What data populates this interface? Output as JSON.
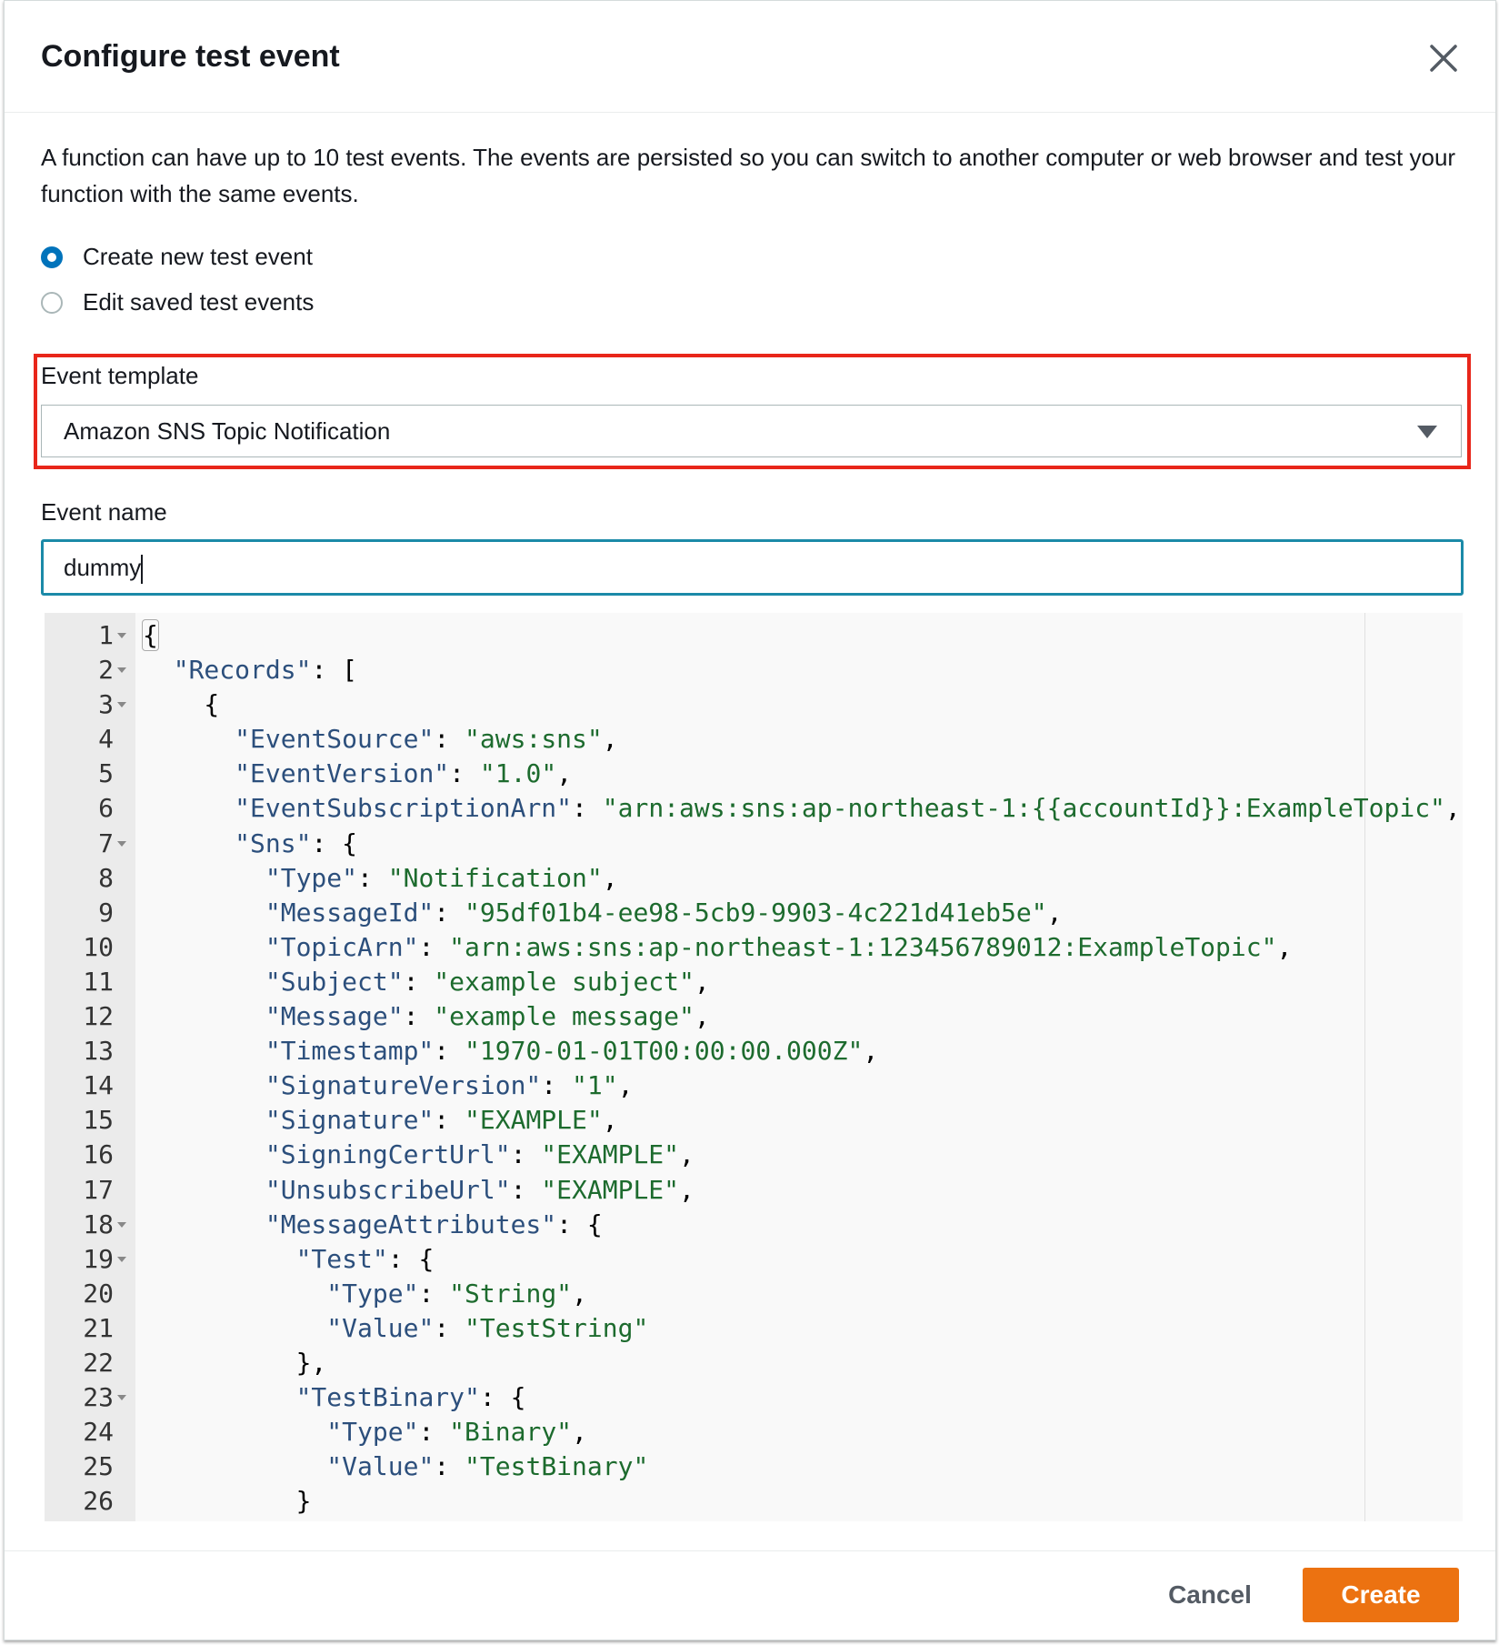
{
  "dialog": {
    "title": "Configure test event",
    "close_icon": "close-icon",
    "description": "A function can have up to 10 test events. The events are persisted so you can switch to another computer or web browser and test your function with the same events.",
    "radios": [
      {
        "label": "Create new test event",
        "checked": true
      },
      {
        "label": "Edit saved test events",
        "checked": false
      }
    ],
    "event_template": {
      "label": "Event template",
      "value": "Amazon SNS Topic Notification",
      "highlight_color": "#e8261a"
    },
    "event_name": {
      "label": "Event name",
      "value": "dummy"
    },
    "editor": {
      "lines": [
        "{",
        "  \"Records\": [",
        "    {",
        "      \"EventSource\": \"aws:sns\",",
        "      \"EventVersion\": \"1.0\",",
        "      \"EventSubscriptionArn\": \"arn:aws:sns:ap-northeast-1:{{accountId}}:ExampleTopic\",",
        "      \"Sns\": {",
        "        \"Type\": \"Notification\",",
        "        \"MessageId\": \"95df01b4-ee98-5cb9-9903-4c221d41eb5e\",",
        "        \"TopicArn\": \"arn:aws:sns:ap-northeast-1:123456789012:ExampleTopic\",",
        "        \"Subject\": \"example subject\",",
        "        \"Message\": \"example message\",",
        "        \"Timestamp\": \"1970-01-01T00:00:00.000Z\",",
        "        \"SignatureVersion\": \"1\",",
        "        \"Signature\": \"EXAMPLE\",",
        "        \"SigningCertUrl\": \"EXAMPLE\",",
        "        \"UnsubscribeUrl\": \"EXAMPLE\",",
        "        \"MessageAttributes\": {",
        "          \"Test\": {",
        "            \"Type\": \"String\",",
        "            \"Value\": \"TestString\"",
        "          },",
        "          \"TestBinary\": {",
        "            \"Type\": \"Binary\",",
        "            \"Value\": \"TestBinary\"",
        "          }",
        "        }"
      ],
      "foldable_lines": [
        1,
        2,
        3,
        7,
        18,
        19,
        23
      ]
    },
    "footer": {
      "cancel_label": "Cancel",
      "create_label": "Create",
      "create_color": "#ec7211"
    }
  }
}
